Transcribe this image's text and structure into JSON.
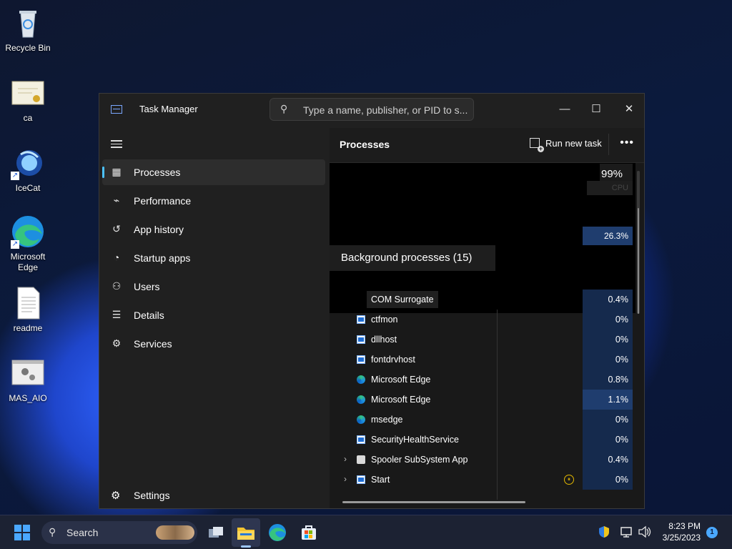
{
  "desktop": {
    "icons": [
      {
        "label": "Recycle Bin"
      },
      {
        "label": "ca"
      },
      {
        "label": "IceCat"
      },
      {
        "label": "Microsoft Edge"
      },
      {
        "label": "readme"
      },
      {
        "label": "MAS_AIO"
      }
    ]
  },
  "window": {
    "title": "Task Manager",
    "search_placeholder": "Type a name, publisher, or PID to s...",
    "minimize": "—",
    "maximize": "☐",
    "close": "✕"
  },
  "nav": {
    "items": [
      {
        "label": "Processes",
        "icon": "▦"
      },
      {
        "label": "Performance",
        "icon": "⌁"
      },
      {
        "label": "App history",
        "icon": "↺"
      },
      {
        "label": "Startup apps",
        "icon": "◔"
      },
      {
        "label": "Users",
        "icon": "⚇"
      },
      {
        "label": "Details",
        "icon": "☰"
      },
      {
        "label": "Services",
        "icon": "⚙"
      }
    ],
    "settings_label": "Settings"
  },
  "main": {
    "title": "Processes",
    "run_new_task": "Run new task",
    "more": "•••",
    "cpu_percent": "99%",
    "cpu_label": "CPU",
    "highlight_value": "26.3%",
    "section_title": "Background processes (15)",
    "rows": [
      {
        "name": "COM Surrogate",
        "cpu": "0.4%"
      },
      {
        "name": "ctfmon",
        "cpu": "0%"
      },
      {
        "name": "dllhost",
        "cpu": "0%"
      },
      {
        "name": "fontdrvhost",
        "cpu": "0%"
      },
      {
        "name": "Microsoft Edge",
        "cpu": "0.8%"
      },
      {
        "name": "Microsoft Edge",
        "cpu": "1.1%"
      },
      {
        "name": "msedge",
        "cpu": "0%"
      },
      {
        "name": "SecurityHealthService",
        "cpu": "0%"
      },
      {
        "name": "Spooler SubSystem App",
        "cpu": "0.4%"
      },
      {
        "name": "Start",
        "cpu": "0%"
      }
    ]
  },
  "taskbar": {
    "search_label": "Search",
    "time": "8:23 PM",
    "date": "3/25/2023",
    "notifications": "1"
  }
}
